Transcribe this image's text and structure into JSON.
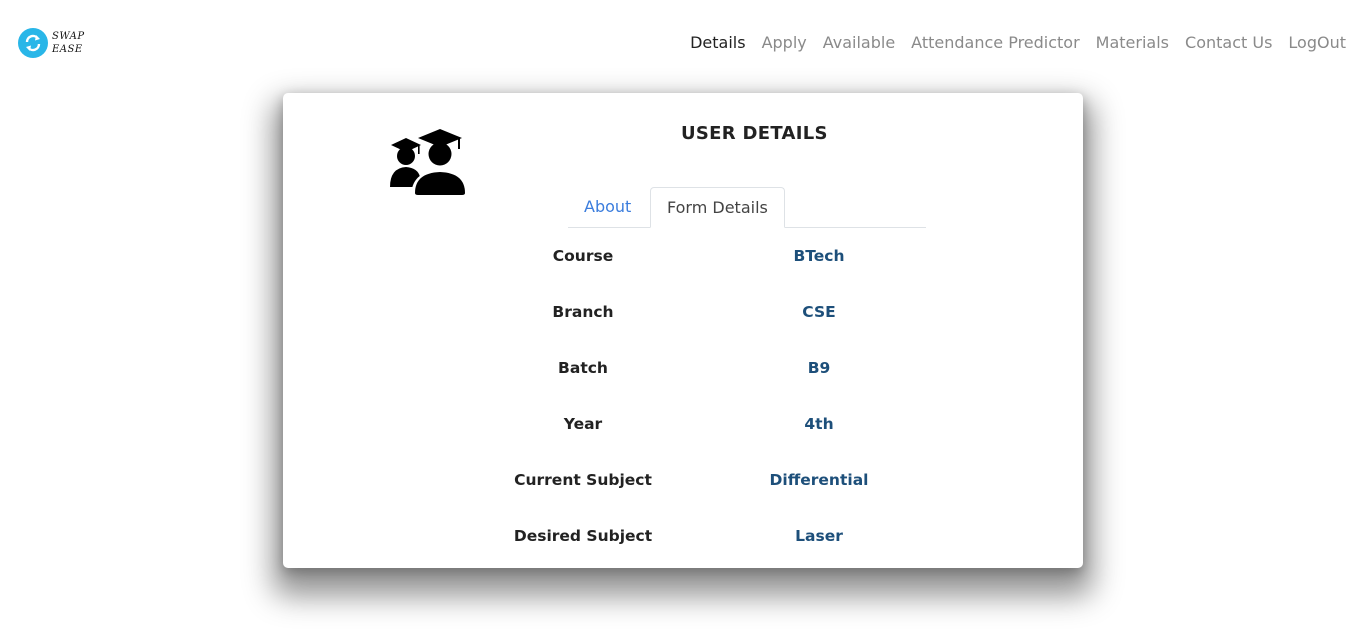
{
  "brand": {
    "line1": "SWAP",
    "line2": "EASE",
    "icon": "refresh-icon",
    "color": "#29b6e8"
  },
  "nav": {
    "items": [
      {
        "label": "Details",
        "active": true
      },
      {
        "label": "Apply",
        "active": false
      },
      {
        "label": "Available",
        "active": false
      },
      {
        "label": "Attendance Predictor",
        "active": false
      },
      {
        "label": "Materials",
        "active": false
      },
      {
        "label": "Contact Us",
        "active": false
      },
      {
        "label": "LogOut",
        "active": false
      }
    ]
  },
  "card": {
    "title": "USER DETAILS",
    "avatar_icon": "graduates-icon",
    "tabs": [
      {
        "label": "About",
        "active": false
      },
      {
        "label": "Form Details",
        "active": true
      }
    ],
    "rows": [
      {
        "label": "Course",
        "value": "BTech"
      },
      {
        "label": "Branch",
        "value": "CSE"
      },
      {
        "label": "Batch",
        "value": "B9"
      },
      {
        "label": "Year",
        "value": "4th"
      },
      {
        "label": "Current Subject",
        "value": "Differential"
      },
      {
        "label": "Desired Subject",
        "value": "Laser"
      }
    ]
  },
  "colors": {
    "link": "#3b7ddd",
    "value": "#1d4f7a",
    "nav_inactive": "#8a8a8a"
  }
}
